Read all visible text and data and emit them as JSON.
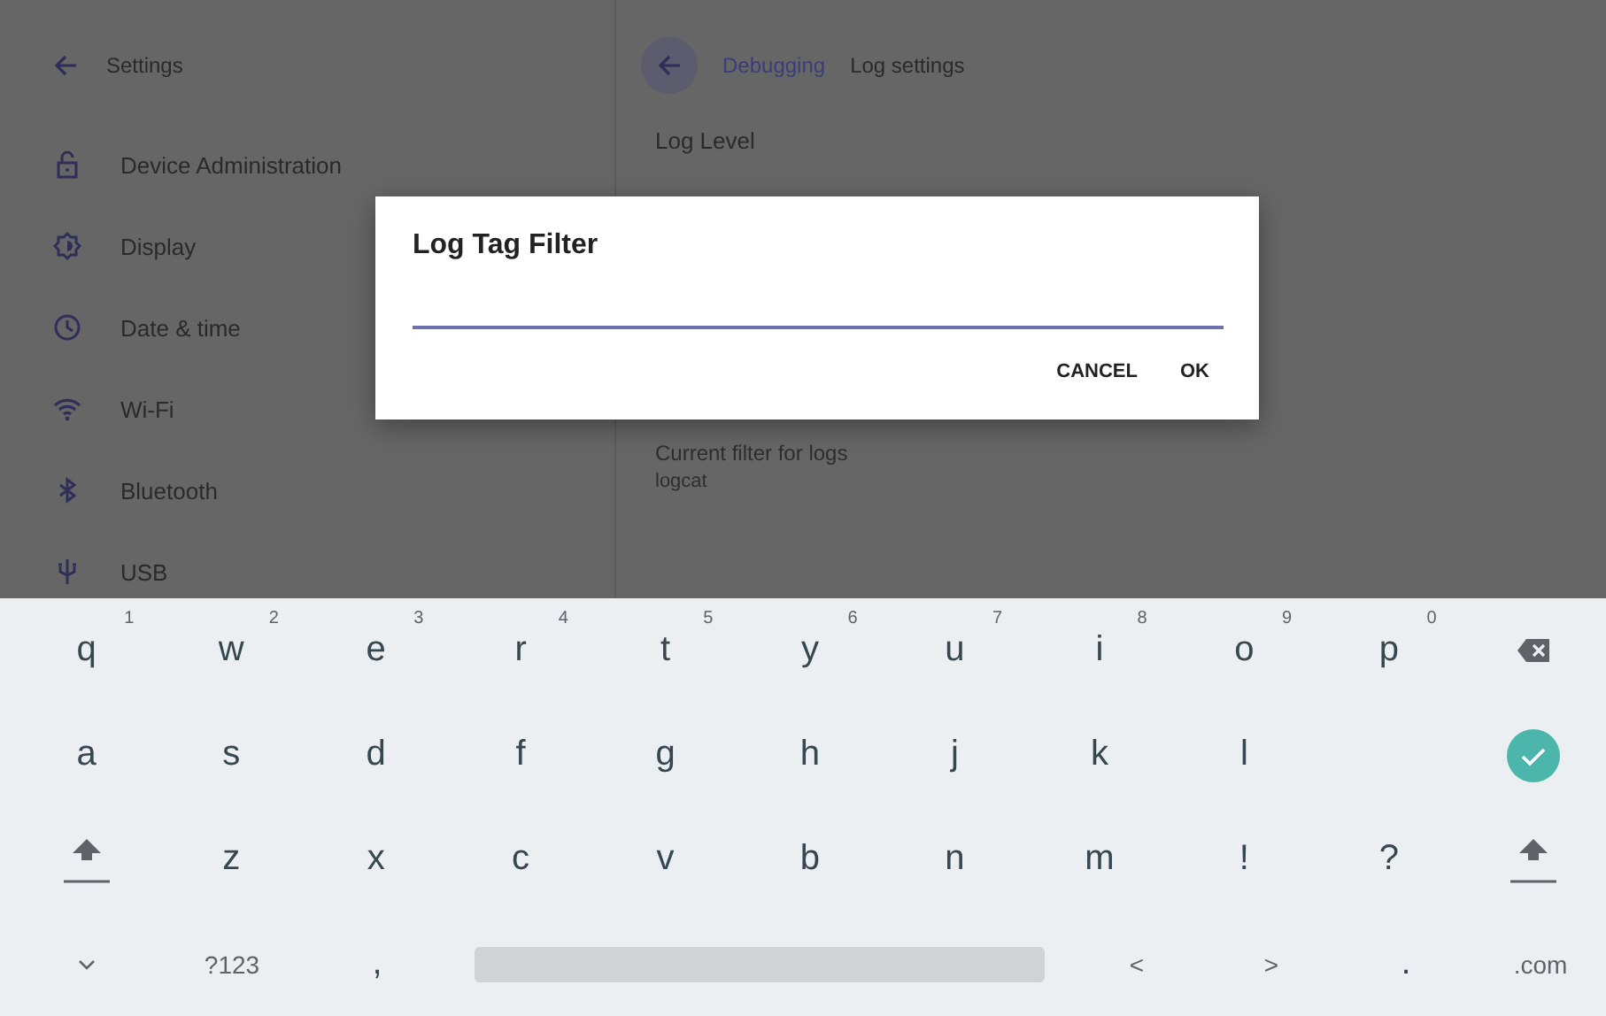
{
  "sidebar": {
    "title": "Settings",
    "items": [
      {
        "label": "Device Administration"
      },
      {
        "label": "Display"
      },
      {
        "label": "Date & time"
      },
      {
        "label": "Wi-Fi"
      },
      {
        "label": "Bluetooth"
      },
      {
        "label": "USB"
      }
    ]
  },
  "detail": {
    "breadcrumb": [
      "Debugging",
      "Log settings"
    ],
    "log_level": {
      "title": "Log Level"
    },
    "filter": {
      "title": "Current filter for logs",
      "value": "logcat"
    }
  },
  "dialog": {
    "title": "Log Tag Filter",
    "buttons": [
      "CANCEL",
      "OK"
    ]
  },
  "keyboard": {
    "rows": [
      [
        {
          "kind": "char",
          "label": "q",
          "hint": "1"
        },
        {
          "kind": "char",
          "label": "w",
          "hint": "2"
        },
        {
          "kind": "char",
          "label": "e",
          "hint": "3"
        },
        {
          "kind": "char",
          "label": "r",
          "hint": "4"
        },
        {
          "kind": "char",
          "label": "t",
          "hint": "5"
        },
        {
          "kind": "char",
          "label": "y",
          "hint": "6"
        },
        {
          "kind": "char",
          "label": "u",
          "hint": "7"
        },
        {
          "kind": "char",
          "label": "i",
          "hint": "8"
        },
        {
          "kind": "char",
          "label": "o",
          "hint": "9"
        },
        {
          "kind": "char",
          "label": "p",
          "hint": "0"
        },
        {
          "kind": "backspace"
        }
      ],
      [
        {
          "kind": "char",
          "label": "a"
        },
        {
          "kind": "char",
          "label": "s"
        },
        {
          "kind": "char",
          "label": "d"
        },
        {
          "kind": "char",
          "label": "f"
        },
        {
          "kind": "char",
          "label": "g"
        },
        {
          "kind": "char",
          "label": "h"
        },
        {
          "kind": "char",
          "label": "j"
        },
        {
          "kind": "char",
          "label": "k"
        },
        {
          "kind": "char",
          "label": "l"
        },
        {
          "kind": "gap"
        },
        {
          "kind": "enter"
        }
      ],
      [
        {
          "kind": "shift"
        },
        {
          "kind": "char",
          "label": "z"
        },
        {
          "kind": "char",
          "label": "x"
        },
        {
          "kind": "char",
          "label": "c"
        },
        {
          "kind": "char",
          "label": "v"
        },
        {
          "kind": "char",
          "label": "b"
        },
        {
          "kind": "char",
          "label": "n"
        },
        {
          "kind": "char",
          "label": "m"
        },
        {
          "kind": "char",
          "label": "!"
        },
        {
          "kind": "char",
          "label": "?"
        },
        {
          "kind": "shift"
        }
      ],
      [
        {
          "kind": "collapse"
        },
        {
          "kind": "small",
          "label": "?123"
        },
        {
          "kind": "char",
          "label": ","
        },
        {
          "kind": "space"
        },
        {
          "kind": "small",
          "label": "<"
        },
        {
          "kind": "small",
          "label": ">"
        },
        {
          "kind": "char",
          "label": "."
        },
        {
          "kind": "small",
          "label": ".com"
        }
      ]
    ]
  }
}
